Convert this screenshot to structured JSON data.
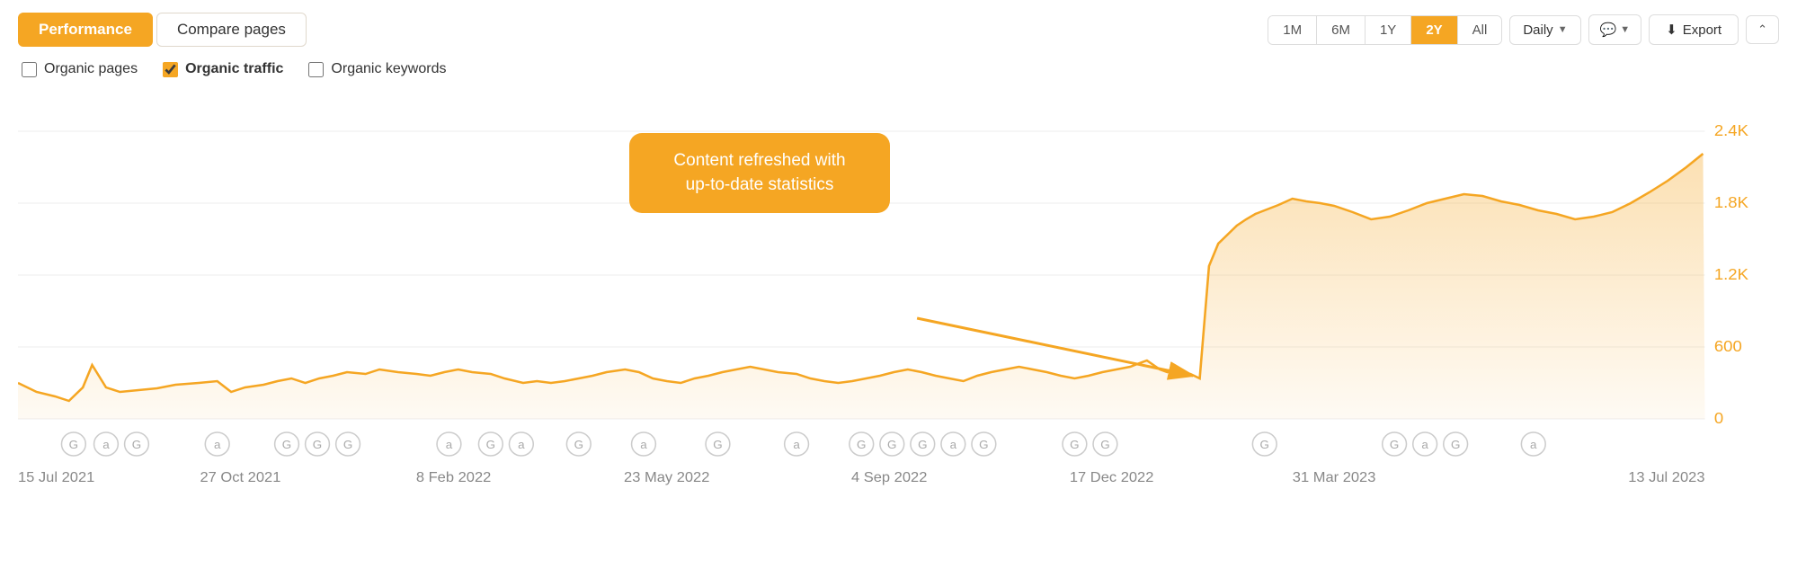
{
  "tabs": [
    {
      "label": "Performance",
      "active": true
    },
    {
      "label": "Compare pages",
      "active": false
    }
  ],
  "timeButtons": [
    {
      "label": "1M",
      "active": false
    },
    {
      "label": "6M",
      "active": false
    },
    {
      "label": "1Y",
      "active": false
    },
    {
      "label": "2Y",
      "active": true
    },
    {
      "label": "All",
      "active": false
    }
  ],
  "dailyDropdown": {
    "label": "Daily"
  },
  "commentButton": {
    "label": "💬"
  },
  "exportButton": {
    "label": "Export"
  },
  "collapseButton": {
    "label": "^"
  },
  "checkboxes": [
    {
      "label": "Organic pages",
      "checked": false,
      "bold": false
    },
    {
      "label": "Organic traffic",
      "checked": true,
      "bold": true
    },
    {
      "label": "Organic keywords",
      "checked": false,
      "bold": false
    }
  ],
  "tooltip": {
    "line1": "Content refreshed with",
    "line2": "up-to-date statistics"
  },
  "yAxis": {
    "labels": [
      "2.4K",
      "1.8K",
      "1.2K",
      "600",
      "0"
    ]
  },
  "xAxis": {
    "labels": [
      "15 Jul 2021",
      "27 Oct 2021",
      "8 Feb 2022",
      "23 May 2022",
      "4 Sep 2022",
      "17 Dec 2022",
      "31 Mar 2023",
      "13 Jul 2023"
    ]
  },
  "chart": {
    "accent": "#f5a623",
    "accentFill": "rgba(245,166,35,0.18)"
  }
}
